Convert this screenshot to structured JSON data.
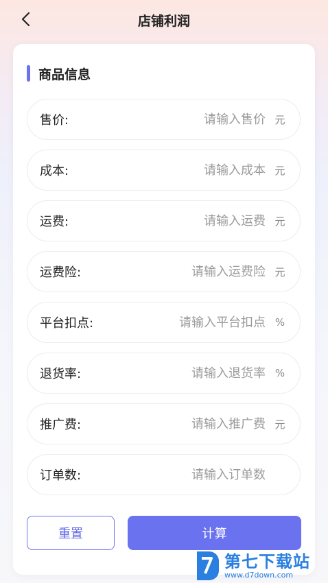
{
  "header": {
    "title": "店铺利润"
  },
  "section": {
    "title": "商品信息"
  },
  "fields": [
    {
      "label": "售价:",
      "placeholder": "请输入售价",
      "unit": "元"
    },
    {
      "label": "成本:",
      "placeholder": "请输入成本",
      "unit": "元"
    },
    {
      "label": "运费:",
      "placeholder": "请输入运费",
      "unit": "元"
    },
    {
      "label": "运费险:",
      "placeholder": "请输入运费险",
      "unit": "元"
    },
    {
      "label": "平台扣点:",
      "placeholder": "请输入平台扣点",
      "unit": "%"
    },
    {
      "label": "退货率:",
      "placeholder": "请输入退货率",
      "unit": "%"
    },
    {
      "label": "推广费:",
      "placeholder": "请输入推广费",
      "unit": "元"
    },
    {
      "label": "订单数:",
      "placeholder": "请输入订单数",
      "unit": ""
    }
  ],
  "buttons": {
    "reset": "重置",
    "calculate": "计算"
  },
  "watermark": {
    "name": "第七下载站",
    "url": "www.d7down.com"
  },
  "icons": {
    "back": "chevron-left-icon",
    "logo": "d7-logo-icon"
  },
  "colors": {
    "accent": "#6b72f0",
    "watermark": "#2a7fe0"
  }
}
